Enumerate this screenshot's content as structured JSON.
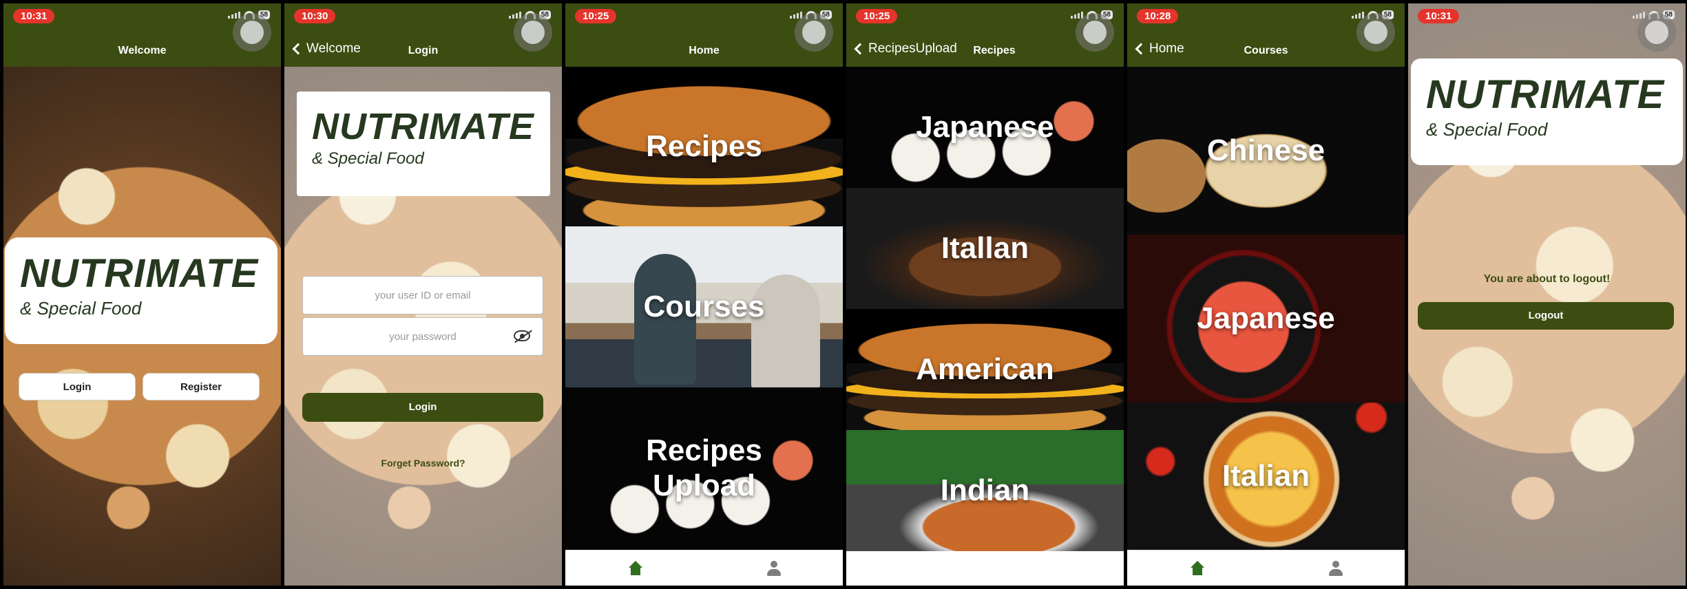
{
  "status": {
    "times": [
      "10:31",
      "10:30",
      "10:25",
      "10:25",
      "10:28",
      "10:31"
    ],
    "battery": "58"
  },
  "brand": {
    "title": "NUTRIMATE",
    "subtitle": "& Special Food"
  },
  "welcome": {
    "nav_title": "Welcome",
    "login_label": "Login",
    "register_label": "Register"
  },
  "login": {
    "back_label": "Welcome",
    "nav_title": "Login",
    "user_placeholder": "your user ID or email",
    "password_placeholder": "your password",
    "login_button": "Login",
    "forgot_link": "Forget Password?"
  },
  "home": {
    "nav_title": "Home",
    "tiles": [
      "Recipes",
      "Courses",
      "Recipes\nUpload"
    ]
  },
  "recipes": {
    "back_label": "RecipesUpload",
    "nav_title": "Recipes",
    "tiles": [
      "Japanese",
      "Itallan",
      "American",
      "Indian"
    ]
  },
  "courses": {
    "back_label": "Home",
    "nav_title": "Courses",
    "tiles": [
      "Chinese",
      "Japanese",
      "Italian"
    ]
  },
  "logout": {
    "message": "You are about to logout!",
    "button": "Logout"
  },
  "colors": {
    "primary": "#3c4d12",
    "status_pill": "#e5342b",
    "brand_text": "#26381f"
  },
  "icons": {
    "tab_home": "home-icon",
    "tab_profile": "user-icon",
    "password_toggle": "eye-off-icon",
    "back": "chevron-left-icon"
  }
}
